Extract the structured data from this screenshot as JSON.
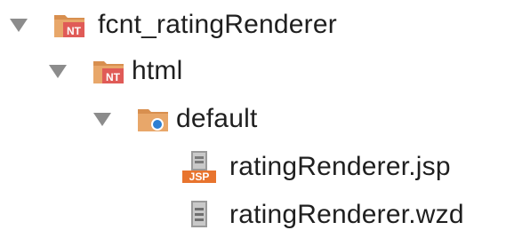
{
  "tree": {
    "root": {
      "label": "fcnt_ratingRenderer",
      "icon": "module-folder-icon",
      "badge": "NT",
      "expanded": true
    },
    "html_folder": {
      "label": "html",
      "icon": "module-folder-icon",
      "badge": "NT",
      "expanded": true
    },
    "default_folder": {
      "label": "default",
      "icon": "package-folder-icon",
      "expanded": true
    },
    "files": [
      {
        "label": "ratingRenderer.jsp",
        "icon": "jsp-file-icon",
        "badge": "JSP"
      },
      {
        "label": "ratingRenderer.wzd",
        "icon": "text-file-icon"
      }
    ]
  },
  "colors": {
    "arrow": "#8c8c8c",
    "folder": "#e8a76a",
    "folder_dark": "#d88f4f",
    "nt_badge": "#e05b57",
    "jsp_badge": "#e8742e",
    "package_dot": "#2d7fd3",
    "text": "#1f1f1f"
  }
}
